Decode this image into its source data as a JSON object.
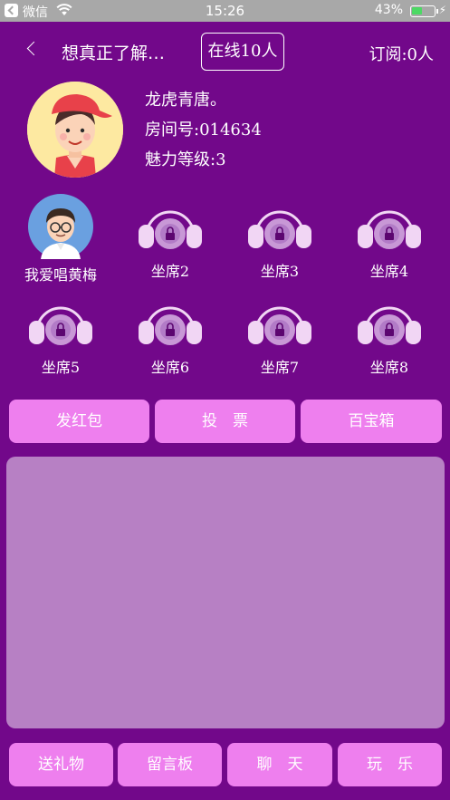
{
  "status_bar": {
    "carrier": "微信",
    "time": "15:26",
    "battery_percent": "43%",
    "battery_level": 0.43
  },
  "header": {
    "title": "想真正了解…",
    "online": "在线10人",
    "subscribe": "订阅:0人"
  },
  "host": {
    "name": "龙虎青唐。",
    "room": "房间号:014634",
    "charm": "魅力等级:3"
  },
  "seats": [
    {
      "label": "我爱唱黄梅",
      "occupied": true
    },
    {
      "label": "坐席2",
      "occupied": false
    },
    {
      "label": "坐席3",
      "occupied": false
    },
    {
      "label": "坐席4",
      "occupied": false
    },
    {
      "label": "坐席5",
      "occupied": false
    },
    {
      "label": "坐席6",
      "occupied": false
    },
    {
      "label": "坐席7",
      "occupied": false
    },
    {
      "label": "坐席8",
      "occupied": false
    }
  ],
  "actions": {
    "red_packet": "发红包",
    "vote": "投　票",
    "treasure": "百宝箱"
  },
  "bottom": {
    "gift": "送礼物",
    "board": "留言板",
    "chat": "聊　天",
    "play": "玩　乐"
  },
  "colors": {
    "background": "#72088a",
    "button": "#ee7fee",
    "chat_panel": "#b780c4"
  }
}
